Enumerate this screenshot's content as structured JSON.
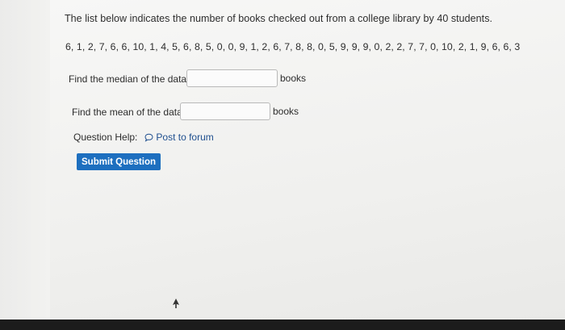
{
  "question": {
    "intro": "The list below indicates the number of books checked out from a college library by 40 students.",
    "dataset": "6, 1, 2, 7, 6, 6, 10, 1, 4, 5, 6, 8, 5, 0, 0, 9, 1, 2, 6, 7, 8, 8, 0, 5, 9, 9, 9, 0, 2, 2, 7, 7, 0, 10, 2, 1, 9, 6, 6, 3"
  },
  "median": {
    "label": "Find the median of the data:",
    "value": "",
    "unit": "books"
  },
  "mean": {
    "label": "Find the mean of the data:",
    "value": "",
    "unit": "books"
  },
  "help": {
    "label": "Question Help:",
    "forum_link": "Post to forum",
    "forum_icon": "speech-bubble-icon"
  },
  "submit": {
    "label": "Submit Question"
  },
  "colors": {
    "accent": "#1d6fbf",
    "link": "#1f4f8f",
    "text": "#2d2d2d"
  }
}
